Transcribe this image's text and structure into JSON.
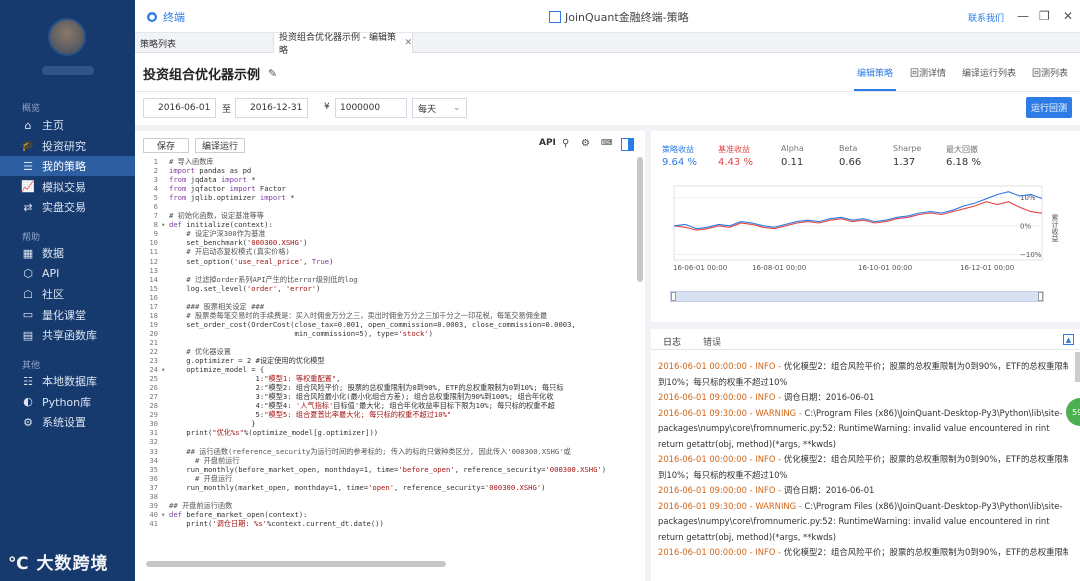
{
  "window": {
    "home_label": "终端",
    "app_title": "JoinQuant金融终端-策略",
    "contact_label": "联系我们"
  },
  "sidebar": {
    "section_overview": "概览",
    "overview_items": [
      {
        "label": "主页",
        "icon": "home-icon"
      },
      {
        "label": "投资研究",
        "icon": "graduation-cap-icon"
      },
      {
        "label": "我的策略",
        "icon": "strategy-icon",
        "active": true
      },
      {
        "label": "模拟交易",
        "icon": "chart-icon"
      },
      {
        "label": "实盘交易",
        "icon": "trade-icon"
      }
    ],
    "section_help": "帮助",
    "help_items": [
      {
        "label": "数据",
        "icon": "data-icon"
      },
      {
        "label": "API",
        "icon": "api-icon"
      },
      {
        "label": "社区",
        "icon": "community-icon"
      },
      {
        "label": "量化课堂",
        "icon": "classroom-icon"
      },
      {
        "label": "共享函数库",
        "icon": "library-icon"
      }
    ],
    "section_other": "其他",
    "other_items": [
      {
        "label": "本地数据库",
        "icon": "database-icon"
      },
      {
        "label": "Python库",
        "icon": "python-icon"
      },
      {
        "label": "系统设置",
        "icon": "settings-icon"
      }
    ],
    "watermark": "大数跨境"
  },
  "tabs": [
    {
      "label": "策略列表"
    },
    {
      "label": "投资组合优化器示例 - 编辑策略",
      "active": true
    }
  ],
  "header": {
    "title": "投资组合优化器示例",
    "right_tabs": [
      "编辑策略",
      "回测详情",
      "编译运行列表",
      "回测列表"
    ]
  },
  "params": {
    "start_date": "2016-06-01",
    "to_label": "至",
    "end_date": "2016-12-31",
    "currency_symbol": "¥",
    "capital": "1000000",
    "frequency": "每天",
    "run_button": "运行回测"
  },
  "editor": {
    "save_label": "保存",
    "compile_label": "编译运行",
    "api_label": "API"
  },
  "code_lines": [
    {
      "n": "1",
      "f": "",
      "t": "# 导入函数库",
      "c": "cm"
    },
    {
      "n": "2",
      "f": "",
      "t": "import pandas as pd",
      "c": ""
    },
    {
      "n": "3",
      "f": "",
      "t": "from jqdata import *",
      "c": ""
    },
    {
      "n": "4",
      "f": "",
      "t": "from jqfactor import Factor",
      "c": ""
    },
    {
      "n": "5",
      "f": "",
      "t": "from jqlib.optimizer import *",
      "c": ""
    },
    {
      "n": "6",
      "f": "",
      "t": "",
      "c": ""
    },
    {
      "n": "7",
      "f": "",
      "t": "# 初始化函数，设定基准等等",
      "c": "cm"
    },
    {
      "n": "8",
      "f": "▾",
      "t": "def initialize(context):",
      "c": ""
    },
    {
      "n": "9",
      "f": "",
      "t": "    # 设定沪深300作为基准",
      "c": "cm"
    },
    {
      "n": "10",
      "f": "",
      "t": "    set_benchmark('000300.XSHG')",
      "c": ""
    },
    {
      "n": "11",
      "f": "",
      "t": "    # 开启动态复权模式(真实价格)",
      "c": "cm"
    },
    {
      "n": "12",
      "f": "",
      "t": "    set_option('use_real_price', True)",
      "c": ""
    },
    {
      "n": "13",
      "f": "",
      "t": "",
      "c": ""
    },
    {
      "n": "14",
      "f": "",
      "t": "    # 过滤掉order系列API产生的比error级别低的log",
      "c": "cm"
    },
    {
      "n": "15",
      "f": "",
      "t": "    log.set_level('order', 'error')",
      "c": ""
    },
    {
      "n": "16",
      "f": "",
      "t": "",
      "c": ""
    },
    {
      "n": "17",
      "f": "",
      "t": "    ### 股票相关设定 ###",
      "c": "cm"
    },
    {
      "n": "18",
      "f": "",
      "t": "    # 股票类每笔交易时的手续费是：买入时佣金万分之三，卖出时佣金万分之三加千分之一印花税，每笔交易佣金最",
      "c": "cm"
    },
    {
      "n": "19",
      "f": "",
      "t": "    set_order_cost(OrderCost(close_tax=0.001, open_commission=0.0003, close_commission=0.0003,",
      "c": ""
    },
    {
      "n": "20",
      "f": "",
      "t": "                             min_commission=5), type='stock')",
      "c": ""
    },
    {
      "n": "21",
      "f": "",
      "t": "",
      "c": ""
    },
    {
      "n": "22",
      "f": "",
      "t": "    # 优化器设置",
      "c": "cm"
    },
    {
      "n": "23",
      "f": "",
      "t": "    g.optimizer = 2 #设定使用的优化模型",
      "c": ""
    },
    {
      "n": "24",
      "f": "▾",
      "t": "    optimize_model = {",
      "c": ""
    },
    {
      "n": "25",
      "f": "",
      "t": "                    1:\"模型1: 等权重配置\",",
      "c": ""
    },
    {
      "n": "26",
      "f": "",
      "t": "                    2:\"模型2: 组合风险平价; 股票的总权重限制为0到90%, ETF的总权重限制为0到10%; 每只标",
      "c": ""
    },
    {
      "n": "27",
      "f": "",
      "t": "                    3:\"模型3: 组合风险最小化(最小化组合方差); 组合总权重限制为90%到100%; 组合年化收",
      "c": ""
    },
    {
      "n": "28",
      "f": "",
      "t": "                    4:\"模型4: '人气指标'目标值'最大化; 组合年化收益率目标下限为10%; 每只标的权重不超",
      "c": ""
    },
    {
      "n": "29",
      "f": "",
      "t": "                    5:\"模型5: 组合夏普比率最大化; 每只标的权重不超过10%\"",
      "c": ""
    },
    {
      "n": "30",
      "f": "",
      "t": "                   }",
      "c": ""
    },
    {
      "n": "31",
      "f": "",
      "t": "    print(\"优化%s\"%(optimize_model[g.optimizer]))",
      "c": ""
    },
    {
      "n": "32",
      "f": "",
      "t": "",
      "c": ""
    },
    {
      "n": "33",
      "f": "",
      "t": "    ## 运行函数(reference_security为运行时间的参考标的; 传入的标的只做种类区分, 因此传入'000300.XSHG'或",
      "c": "cm"
    },
    {
      "n": "34",
      "f": "",
      "t": "      # 开盘前运行",
      "c": "cm"
    },
    {
      "n": "35",
      "f": "",
      "t": "    run_monthly(before_market_open, monthday=1, time='before_open', reference_security='000300.XSHG')",
      "c": ""
    },
    {
      "n": "36",
      "f": "",
      "t": "      # 开盘运行",
      "c": "cm"
    },
    {
      "n": "37",
      "f": "",
      "t": "    run_monthly(market_open, monthday=1, time='open', reference_security='000300.XSHG')",
      "c": ""
    },
    {
      "n": "38",
      "f": "",
      "t": "",
      "c": ""
    },
    {
      "n": "39",
      "f": "",
      "t": "## 开盘前运行函数",
      "c": "cm"
    },
    {
      "n": "40",
      "f": "▾",
      "t": "def before_market_open(context):",
      "c": ""
    },
    {
      "n": "41",
      "f": "",
      "t": "    print('调仓日期: %s'%context.current_dt.date())",
      "c": ""
    }
  ],
  "stats": [
    {
      "label": "策略收益",
      "value": "9.64 %",
      "color": "#2d7be5"
    },
    {
      "label": "基准收益",
      "value": "4.43 %",
      "color": "#e04545"
    },
    {
      "label": "Alpha",
      "value": "0.11",
      "color": "#333333"
    },
    {
      "label": "Beta",
      "value": "0.66",
      "color": "#333333"
    },
    {
      "label": "Sharpe",
      "value": "1.37",
      "color": "#333333"
    },
    {
      "label": "最大回撤",
      "value": "6.18 %",
      "color": "#333333"
    }
  ],
  "chart_data": {
    "type": "line",
    "x_ticks": [
      "16-06-01 00:00",
      "16-08-01 00:00",
      "16-10-01 00:00",
      "16-12-01 00:00"
    ],
    "y_ticks": [
      "10%",
      "0%",
      "−10%"
    ],
    "ylim": [
      -12,
      14
    ],
    "ylabel": "累计收益",
    "series": [
      {
        "name": "策略收益",
        "color": "#2d7be5",
        "values": [
          0,
          0.5,
          -1,
          -0.5,
          0.5,
          0,
          1.5,
          1,
          0,
          -0.5,
          0.5,
          1.5,
          2,
          1.5,
          2.5,
          3,
          2,
          2.5,
          1.5,
          2,
          3,
          3.5,
          4.5,
          5,
          4.5,
          5.5,
          7,
          8,
          9.5,
          11,
          12,
          10.5,
          11,
          9.6
        ]
      },
      {
        "name": "基准收益",
        "color": "#e04545",
        "values": [
          0,
          -0.5,
          -1.5,
          -1,
          0,
          -0.5,
          1,
          0.5,
          -0.5,
          -1,
          0,
          1,
          1.5,
          1,
          2,
          2.5,
          1.5,
          2,
          1,
          1.5,
          2.5,
          3,
          4,
          4.5,
          4,
          5,
          6,
          7,
          8.5,
          7.5,
          8.5,
          6.5,
          5,
          4.43
        ]
      }
    ]
  },
  "logs": {
    "tab_log": "日志",
    "tab_error": "错误",
    "lines": [
      {
        "ts": "2016-06-01 00:00:00",
        "lvl": "INFO",
        "msg": "优化模型2：组合风险平价；股票的总权重限制为0到90%，ETF的总权重限制为0"
      },
      {
        "ts": "",
        "lvl": "",
        "msg": "到10%；每只标的权重不超过10%"
      },
      {
        "ts": "2016-06-01 09:00:00",
        "lvl": "INFO",
        "msg": "调仓日期：2016-06-01"
      },
      {
        "ts": "2016-06-01 09:30:00",
        "lvl": "WARNING",
        "msg": "C:\\Program Files (x86)\\JoinQuant-Desktop-Py3\\Python\\lib\\site-"
      },
      {
        "ts": "",
        "lvl": "",
        "msg": "packages\\numpy\\core\\fromnumeric.py:52: RuntimeWarning: invalid value encountered in rint"
      },
      {
        "ts": "",
        "lvl": "",
        "msg": "return getattr(obj, method)(*args, **kwds)"
      },
      {
        "ts": "2016-06-01 00:00:00",
        "lvl": "INFO",
        "msg": "优化模型2：组合风险平价；股票的总权重限制为0到90%，ETF的总权重限制为0"
      },
      {
        "ts": "",
        "lvl": "",
        "msg": "到10%；每只标的权重不超过10%"
      },
      {
        "ts": "2016-06-01 09:00:00",
        "lvl": "INFO",
        "msg": "调仓日期：2016-06-01"
      },
      {
        "ts": "2016-06-01 09:30:00",
        "lvl": "WARNING",
        "msg": "C:\\Program Files (x86)\\JoinQuant-Desktop-Py3\\Python\\lib\\site-"
      },
      {
        "ts": "",
        "lvl": "",
        "msg": "packages\\numpy\\core\\fromnumeric.py:52: RuntimeWarning: invalid value encountered in rint"
      },
      {
        "ts": "",
        "lvl": "",
        "msg": "return getattr(obj, method)(*args, **kwds)"
      },
      {
        "ts": "2016-06-01 00:00:00",
        "lvl": "INFO",
        "msg": "优化模型2：组合风险平价；股票的总权重限制为0到90%，ETF的总权重限制为0"
      }
    ]
  },
  "float_badge": "59"
}
